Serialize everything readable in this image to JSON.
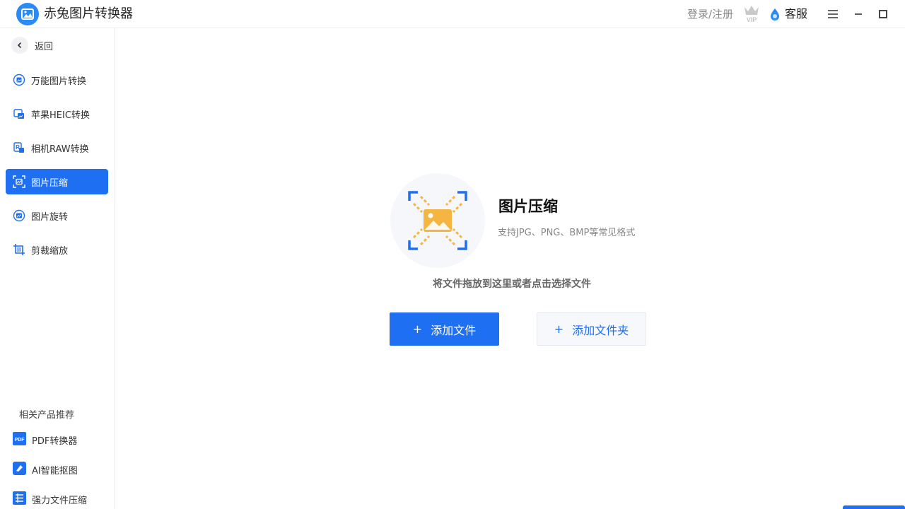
{
  "app": {
    "title": "赤兔图片转换器"
  },
  "header": {
    "login": "登录/注册",
    "vip_icon": "vip-crown-icon",
    "service": "客服"
  },
  "sidebar": {
    "back": "返回",
    "items": [
      {
        "label": "万能图片转换",
        "icon": "image-convert-icon"
      },
      {
        "label": "苹果HEIC转换",
        "icon": "heic-icon"
      },
      {
        "label": "相机RAW转换",
        "icon": "raw-icon"
      },
      {
        "label": "图片压缩",
        "icon": "compress-icon",
        "active": true
      },
      {
        "label": "图片旋转",
        "icon": "rotate-icon"
      },
      {
        "label": "剪裁缩放",
        "icon": "crop-icon"
      }
    ],
    "related_title": "相关产品推荐",
    "products": [
      {
        "label": "PDF转换器",
        "icon": "pdf-icon"
      },
      {
        "label": "AI智能抠图",
        "icon": "ai-cutout-icon"
      },
      {
        "label": "强力文件压缩",
        "icon": "file-compress-icon"
      }
    ]
  },
  "main": {
    "feature_title": "图片压缩",
    "feature_desc": "支持JPG、PNG、BMP等常见格式",
    "drop_hint": "将文件拖放到这里或者点击选择文件",
    "add_file": "添加文件",
    "add_folder": "添加文件夹",
    "plus": "+"
  },
  "colors": {
    "accent": "#1f6ff2",
    "hero_orange": "#f5b541"
  }
}
